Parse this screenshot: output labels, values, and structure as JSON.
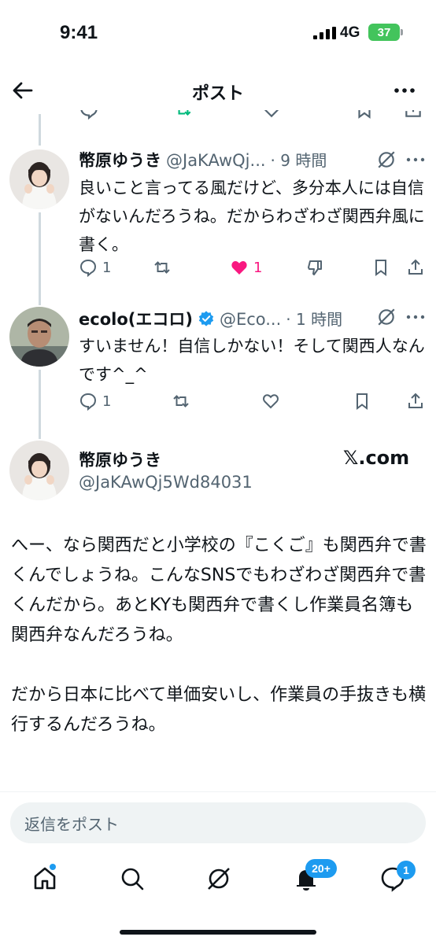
{
  "status_bar": {
    "time": "9:41",
    "network": "4G",
    "battery": "37"
  },
  "header": {
    "title": "ポスト"
  },
  "replies": [
    {
      "name": "幣原ゆうき",
      "handle": "@JaKAwQj...",
      "time": "· 9 時間",
      "text": "良いこと言ってる風だけど、多分本人には自信がないんだろうね。だからわざわざ関西弁風に書く。",
      "reply_count": "1",
      "like_count": "1"
    },
    {
      "name": "ecolo(エコロ)",
      "handle": "@Eco...",
      "time": "· 1 時間",
      "text": "すいません！自信しかない！そして関西人なんです^_^",
      "reply_count": "1"
    }
  ],
  "main_post": {
    "name": "幣原ゆうき",
    "handle": "@JaKAwQj5Wd84031",
    "source": "𝕏.com",
    "paragraphs": [
      "へー、なら関西だと小学校の『こくご』も関西弁で書くんでしょうね。こんなSNSでもわざわざ関西弁で書くんだから。あとKYも関西弁で書くし作業員名簿も関西弁なんだろうね。",
      "だから日本に比べて単価安いし、作業員の手抜きも横行するんだろうね。"
    ]
  },
  "reply_box": {
    "placeholder": "返信をポスト"
  },
  "bottom_nav": {
    "notifications_badge": "20+",
    "messages_badge": "1"
  },
  "colors": {
    "accent": "#1d9bf0",
    "like": "#f91880",
    "retweet": "#00ba7c",
    "verified": "#1d9bf0"
  }
}
